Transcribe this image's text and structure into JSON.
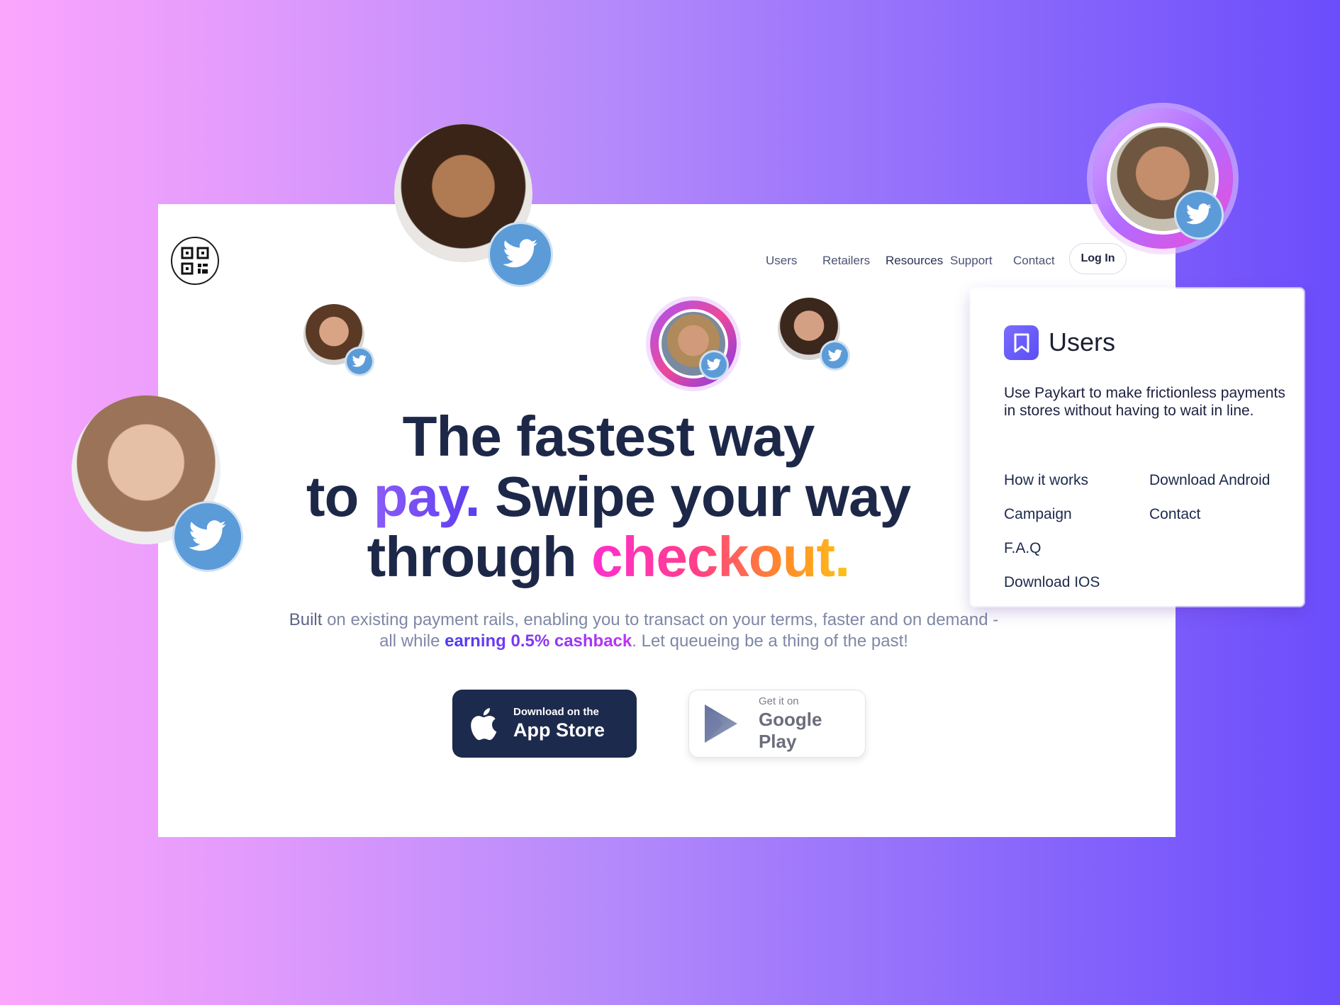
{
  "nav": {
    "items": [
      "Users",
      "Retailers",
      "Resources",
      "Support",
      "Contact"
    ],
    "login_label": "Log In"
  },
  "hero": {
    "line1": "The fastest way",
    "line2_pre": "to ",
    "line2_accent": "pay.",
    "line2_post": " Swipe your way",
    "line3_pre": "through ",
    "line3_accent": "checkout.",
    "sub_built": "Built",
    "sub_part1": " on existing payment rails, enabling you to transact on your terms, faster and on demand -",
    "sub_part2": "all while ",
    "sub_highlight": "earning 0.5% cashback",
    "sub_part3": ". Let queueing be a thing of the past!"
  },
  "buttons": {
    "appstore_small": "Download on the",
    "appstore_big": "App Store",
    "play_small": "Get it on",
    "play_big": "Google Play"
  },
  "dropdown": {
    "title": "Users",
    "description": "Use Paykart to make frictionless payments in stores without having to wait in line.",
    "links_left": [
      "How it works",
      "Campaign",
      "F.A.Q",
      "Download IOS"
    ],
    "links_right": [
      "Download Android",
      "Contact"
    ]
  },
  "colors": {
    "navy": "#1d2849",
    "twitter": "#5b9bd8",
    "accent_purple": "#6b4dfb",
    "accent_pink": "#ff2fd0"
  },
  "icons": [
    "qr-code-icon",
    "bookmark-icon",
    "apple-icon",
    "google-play-icon",
    "twitter-icon"
  ]
}
